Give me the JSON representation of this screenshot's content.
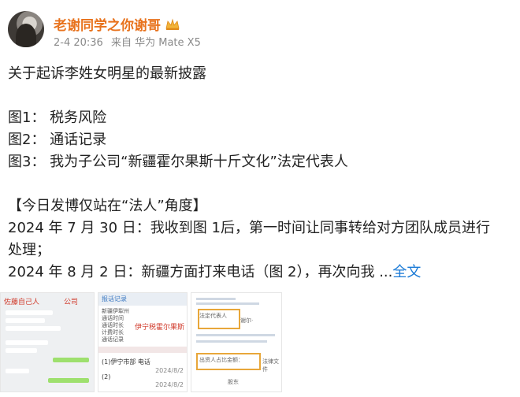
{
  "author": {
    "name": "老谢同学之你谢哥",
    "date": "2-4 20:36",
    "source": "来自 华为 Mate X5"
  },
  "post": {
    "title": "关于起诉李姓女明星的最新披露",
    "items": [
      "图1： 税务风险",
      "图2： 通话记录",
      "图3： 我为子公司“新疆霍尔果斯十斤文化”法定代表人"
    ],
    "stance": "【今日发博仅站在“法人”角度】",
    "p1_line1": "2024 年 7 月 30 日：我收到图 1后，第一时间让同事转给对方团队成员进行",
    "p1_line2": "处理；",
    "p2": "2024 年 8 月 2 日：新疆方面打来电话（图 2），再次向我 ...",
    "more": "全文"
  },
  "thumbs": {
    "t1": {
      "title": "佐藤自己人",
      "title2": "公司"
    },
    "t2": {
      "head": "报话记录",
      "rows": [
        "新疆伊犁州",
        "通话时间",
        "通话时长",
        "计费时长",
        "通话记录"
      ],
      "red": "伊宁税霍尔果斯",
      "r1": "(1)伊宁市部 电话",
      "r2": "(2)",
      "d1": "2024/8/2",
      "d2": "2024/8/2"
    },
    "t3": {
      "t1": "法定代表人",
      "t2": "谢尔·",
      "t3": "出资人占比金额：",
      "t4": "法律文件",
      "t5": "股东"
    }
  }
}
